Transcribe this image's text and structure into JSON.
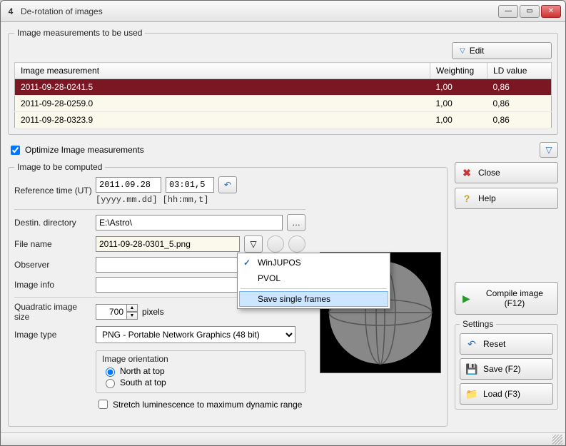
{
  "window": {
    "title": "De-rotation of images"
  },
  "measurements": {
    "legend": "Image measurements to be used",
    "edit_label": "Edit",
    "columns": {
      "name": "Image measurement",
      "weight": "Weighting",
      "ld": "LD value"
    },
    "rows": [
      {
        "name": "2011-09-28-0241.5",
        "weight": "1,00",
        "ld": "0,86",
        "selected": true
      },
      {
        "name": "2011-09-28-0259.0",
        "weight": "1,00",
        "ld": "0,86",
        "selected": false
      },
      {
        "name": "2011-09-28-0323.9",
        "weight": "1,00",
        "ld": "0,86",
        "selected": false
      }
    ],
    "optimize_label": "Optimize Image measurements",
    "optimize_checked": true
  },
  "compute": {
    "legend": "Image to be computed",
    "ref_time_label": "Reference time (UT)",
    "ref_date": "2011.09.28",
    "ref_time": "03:01,5",
    "ref_hint": "[yyyy.mm.dd] [hh:mm,t]",
    "dest_dir_label": "Destin. directory",
    "dest_dir": "E:\\Astro\\",
    "file_name_label": "File name",
    "file_name": "2011-09-28-0301_5.png",
    "observer_label": "Observer",
    "observer": "",
    "image_info_label": "Image info",
    "image_info": "",
    "quad_size_label": "Quadratic image size",
    "quad_size": "700",
    "quad_unit": "pixels",
    "image_type_label": "Image type",
    "image_type": "PNG  - Portable Network Graphics (48 bit)",
    "orientation": {
      "legend": "Image orientation",
      "north": "North at top",
      "south": "South at top",
      "value": "north"
    },
    "stretch_label": "Stretch luminescence to maximum dynamic range",
    "stretch_checked": false
  },
  "dropdown": {
    "items": [
      {
        "label": "WinJUPOS",
        "checked": true
      },
      {
        "label": "PVOL",
        "checked": false
      }
    ],
    "sep_after": 1,
    "highlighted": "Save single frames"
  },
  "side": {
    "close": "Close",
    "help": "Help",
    "compile": "Compile image (F12)",
    "settings_legend": "Settings",
    "reset": "Reset",
    "save": "Save (F2)",
    "load": "Load (F3)"
  }
}
